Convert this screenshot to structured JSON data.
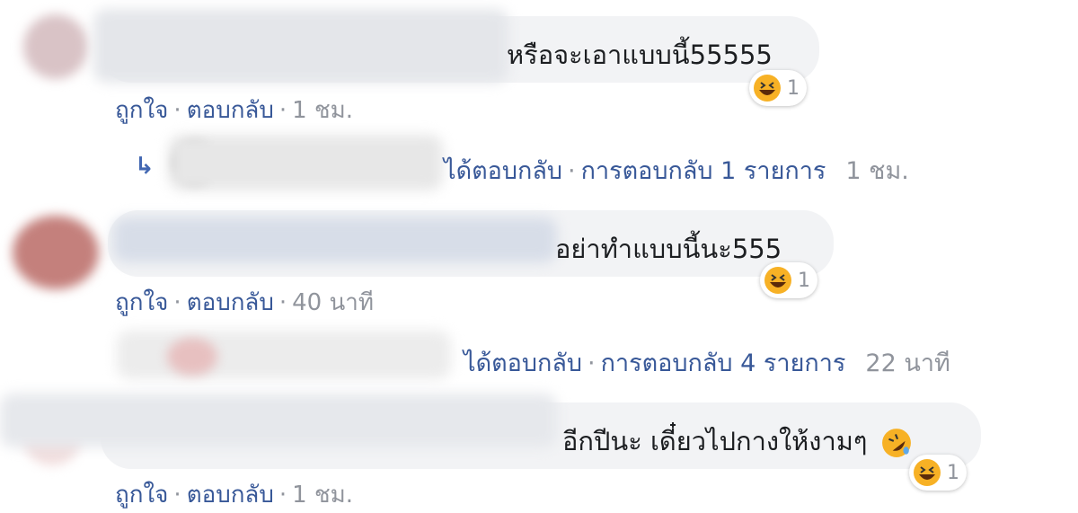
{
  "comments": [
    {
      "text": "หรือจะเอาแบบนี้55555",
      "like": "ถูกใจ",
      "reply": "ตอบกลับ",
      "time": "1 ชม.",
      "reaction_icon": "haha-icon",
      "reaction_count": "1",
      "replies_summary": {
        "label": "ได้ตอบกลับ",
        "count_text": "การตอบกลับ 1 รายการ",
        "time": "1 ชม."
      }
    },
    {
      "text": "อย่าทำแบบนี้นะ555",
      "like": "ถูกใจ",
      "reply": "ตอบกลับ",
      "time": "40 นาที",
      "reaction_icon": "haha-icon",
      "reaction_count": "1",
      "replies_summary": {
        "label": "ได้ตอบกลับ",
        "count_text": "การตอบกลับ 4 รายการ",
        "time": "22 นาที"
      }
    },
    {
      "text": "อีกปีนะ เดี๋ยวไปกางให้งามๆ",
      "like": "ถูกใจ",
      "reply": "ตอบกลับ",
      "time": "1 ชม.",
      "reaction_icon": "haha-icon",
      "reaction_count": "1"
    }
  ],
  "colors": {
    "link": "#385898",
    "meta": "#90949c",
    "bubble": "#f2f3f5",
    "haha": "#f7b125"
  }
}
